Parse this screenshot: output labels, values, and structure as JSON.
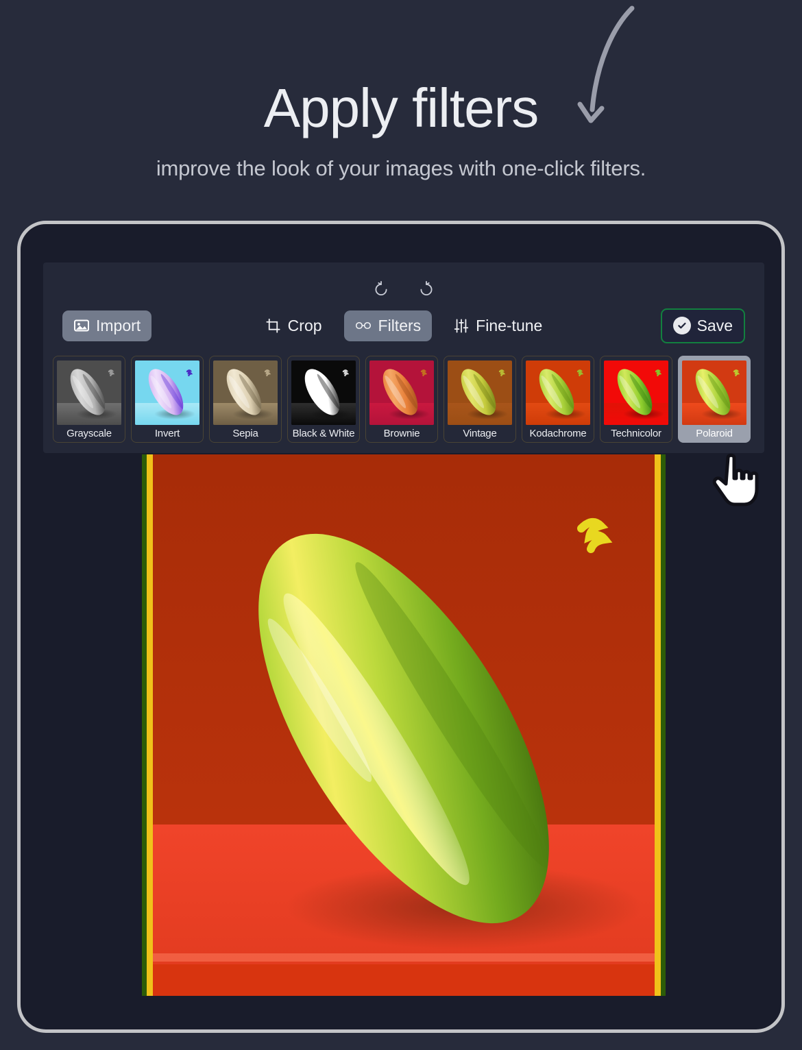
{
  "header": {
    "title": "Apply filters",
    "subtitle": "improve the look of your images with one-click filters.",
    "arrow_icon": "curved-arrow-down-icon"
  },
  "colors": {
    "page_background": "#272b3b",
    "device_border": "#c3c4c7",
    "device_body": "#191c2b",
    "panel_background": "#242838",
    "accent_save_border": "#12803f",
    "active_tool_background": "#6d7688",
    "import_button_background": "#737b8c",
    "selected_filter_background": "#9aa0ad",
    "text_primary": "#f1f2f5",
    "text_secondary": "#c4c7d0"
  },
  "toolbar": {
    "history": [
      {
        "name": "undo",
        "icon": "undo-icon"
      },
      {
        "name": "redo",
        "icon": "redo-icon"
      }
    ],
    "import_label": "Import",
    "import_icon": "image-icon",
    "tools": [
      {
        "label": "Crop",
        "icon": "crop-icon",
        "active": false
      },
      {
        "label": "Filters",
        "icon": "spectacles-icon",
        "active": true
      },
      {
        "label": "Fine-tune",
        "icon": "sliders-icon",
        "active": false
      }
    ],
    "save_label": "Save",
    "save_icon": "check-circle-icon"
  },
  "filters": [
    {
      "label": "Grayscale",
      "selected": false,
      "bg": "#4d4d4d",
      "body_light": "#b4b4b4",
      "body_dark": "#3a3a3a",
      "floor": "#6f6f6f",
      "highlight": "#d8d8d8",
      "stem": "#9a9a9a"
    },
    {
      "label": "Invert",
      "selected": false,
      "bg": "#76d7ef",
      "body_light": "#d6b4f2",
      "body_dark": "#5b2fd6",
      "floor": "#a9e8f6",
      "highlight": "#efe0fb",
      "stem": "#4a2bc4"
    },
    {
      "label": "Sepia",
      "selected": false,
      "bg": "#6f5f45",
      "body_light": "#ddd0b2",
      "body_dark": "#6a5c41",
      "floor": "#9d8a68",
      "highlight": "#f1e8d2",
      "stem": "#b8a888"
    },
    {
      "label": "Black & White",
      "selected": false,
      "bg": "#0a0a0a",
      "body_light": "#ffffff",
      "body_dark": "#090909",
      "floor": "#2e2e2e",
      "highlight": "#ffffff",
      "stem": "#d4d4d4"
    },
    {
      "label": "Brownie",
      "selected": false,
      "bg": "#b4133a",
      "body_light": "#e8803a",
      "body_dark": "#9b4a18",
      "floor": "#c9183f",
      "highlight": "#f5a765",
      "stem": "#c4701f"
    },
    {
      "label": "Vintage",
      "selected": false,
      "bg": "#9c4e15",
      "body_light": "#c5cb3d",
      "body_dark": "#6d7a12",
      "floor": "#a8551a",
      "highlight": "#e2e46a",
      "stem": "#b9bb34"
    },
    {
      "label": "Kodachrome",
      "selected": false,
      "bg": "#cf3c08",
      "body_light": "#a9d13a",
      "body_dark": "#5d8c10",
      "floor": "#e24a12",
      "highlight": "#d9ea6b",
      "stem": "#9bbd2c"
    },
    {
      "label": "Technicolor",
      "selected": false,
      "bg": "#f20a08",
      "body_light": "#8fcf2e",
      "body_dark": "#2f7a10",
      "floor": "#e11206",
      "highlight": "#d2e85c",
      "stem": "#84c62a"
    },
    {
      "label": "Polaroid",
      "selected": true,
      "bg": "#d23a12",
      "body_light": "#a8d23c",
      "body_dark": "#5f9312",
      "floor": "#ee4a1c",
      "highlight": "#e8f06a",
      "stem": "#bcca2f"
    }
  ],
  "preview": {
    "alt": "green zucchini on red background with polaroid filter applied",
    "background_top": "#b5300a",
    "background_floor": "#f2432a",
    "body_light": "#b8d93c",
    "body_mid": "#86c02a",
    "body_dark": "#4e7f10",
    "highlight": "#f8f26a",
    "shadow": "#a62a12",
    "fringe_left": "#f0c21a",
    "fringe_green": "#2d5c08"
  },
  "cursor": {
    "icon": "pointing-hand-cursor"
  }
}
